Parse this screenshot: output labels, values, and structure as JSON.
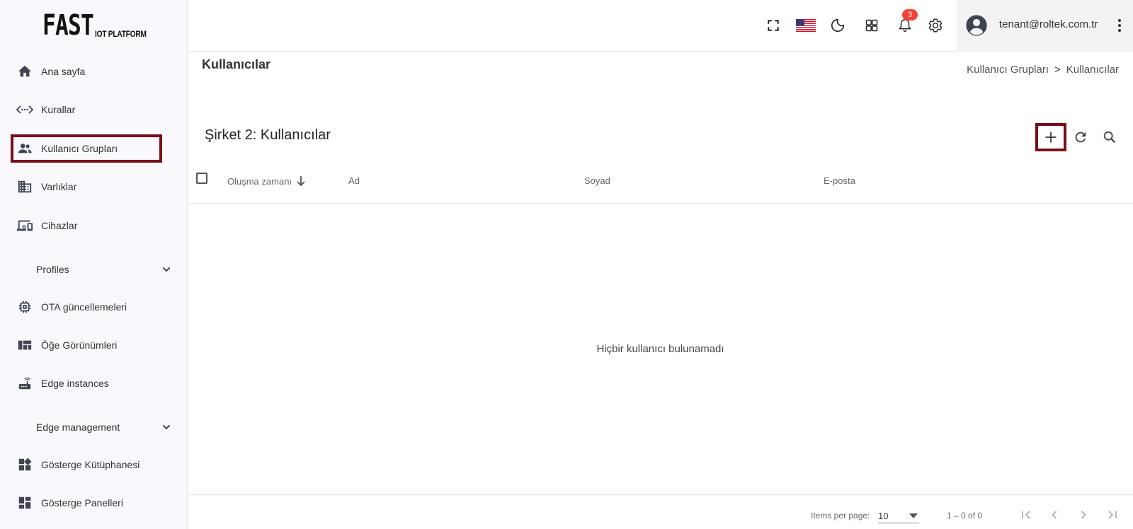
{
  "logo": {
    "main": "FAST",
    "sub": "IOT PLATFORM"
  },
  "sidebar": {
    "items": [
      {
        "label": "Ana sayfa",
        "icon": "home-icon"
      },
      {
        "label": "Kurallar",
        "icon": "rule-chain-icon"
      },
      {
        "label": "Kullanıcı Grupları",
        "icon": "user-group-icon",
        "highlighted": true
      },
      {
        "label": "Varlıklar",
        "icon": "domain-icon"
      },
      {
        "label": "Cihazlar",
        "icon": "devices-icon"
      },
      {
        "label": "Profiles",
        "icon": "chevron-down-icon",
        "group": true
      },
      {
        "label": "OTA güncellemeleri",
        "icon": "memory-chip-icon"
      },
      {
        "label": "Öğe Görünümleri",
        "icon": "view-quilt-icon"
      },
      {
        "label": "Edge instances",
        "icon": "router-icon"
      },
      {
        "label": "Edge management",
        "icon": "chevron-down-icon",
        "group": true
      },
      {
        "label": "Gösterge Kütüphanesi",
        "icon": "widgets-icon"
      },
      {
        "label": "Gösterge Panelleri",
        "icon": "dashboard-icon"
      }
    ]
  },
  "topbar": {
    "notifications_count": "3",
    "user_email": "tenant@roltek.com.tr",
    "icons": [
      "fullscreen-icon",
      "us-flag-icon",
      "dark-mode-icon",
      "apps-grid-icon",
      "bell-icon",
      "settings-icon",
      "account-circle-icon",
      "more-vert-icon"
    ]
  },
  "page": {
    "title": "Kullanıcılar",
    "breadcrumb": [
      "Kullanıcı Grupları",
      ">",
      "Kullanıcılar"
    ]
  },
  "table": {
    "title": "Şirket 2: Kullanıcılar",
    "columns": [
      "Oluşma zamanı",
      "Ad",
      "Soyad",
      "E-posta"
    ],
    "sort_column": "Oluşma zamanı",
    "sort_direction": "desc",
    "rows": [],
    "empty_message": "Hiçbir kullanıcı bulunamadı"
  },
  "pagination": {
    "items_per_page_label": "Items per page:",
    "items_per_page": "10",
    "range": "1 – 0 of 0"
  },
  "colors": {
    "highlight_border": "#7a0e17",
    "badge": "#f44336",
    "sidebar_bg": "#f8f8fd"
  }
}
